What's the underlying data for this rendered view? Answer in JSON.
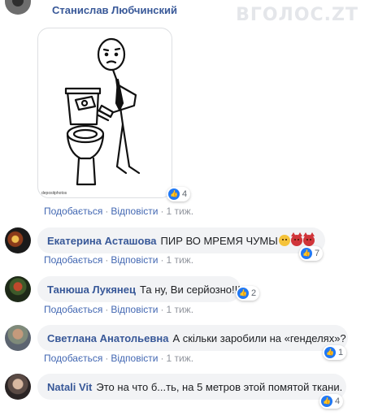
{
  "site": {
    "watermark": "ВГОЛОС.ZT"
  },
  "post": {
    "author": "Станислав Любчинский",
    "image_caption": "depositphotos",
    "reactions": "4",
    "actions": {
      "like": "Подобається",
      "reply": "Відповісти",
      "time": "1 тиж."
    }
  },
  "comments": [
    {
      "author": "Екатерина Асташова",
      "text": "ПИР ВО МРЕМЯ ЧУМЫ",
      "emojis": [
        "angry-face",
        "devil-face",
        "devil-face"
      ],
      "reactions": "7",
      "like": "Подобається",
      "reply": "Відповісти",
      "time": "1 тиж."
    },
    {
      "author": "Танюша Лукянец",
      "text": "Та ну, Ви серйозно!!!",
      "reactions": "2",
      "like": "Подобається",
      "reply": "Відповісти",
      "time": "1 тиж."
    },
    {
      "author": "Светлана Анатольевна",
      "text": "А скільки заробили на «генделях»?",
      "reactions": "1",
      "like": "Подобається",
      "reply": "Відповісти",
      "time": "1 тиж."
    },
    {
      "author": "Natali Vit",
      "text": "Это на что б...ть, на 5 метров этой помятой ткани.",
      "reactions": "4"
    }
  ],
  "colors": {
    "link": "#385898",
    "action": "#4267b2",
    "bubble": "#f2f3f5",
    "like": "#2078f4",
    "meta": "#90949c"
  }
}
